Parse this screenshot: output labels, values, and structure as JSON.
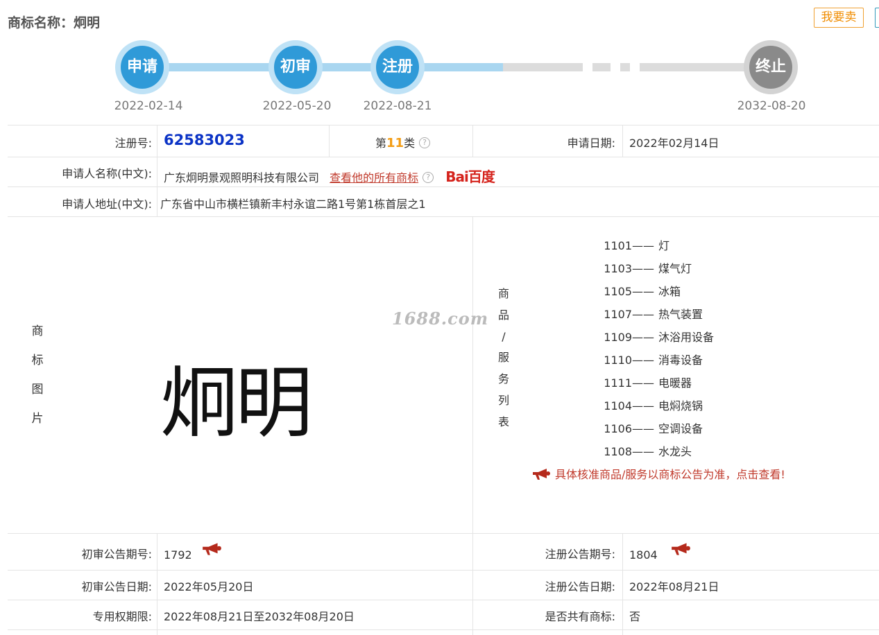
{
  "header": {
    "title": "商标名称：炯明",
    "sell_button": "我要卖"
  },
  "progress": {
    "steps": [
      {
        "label": "申请",
        "date": "2022-02-14"
      },
      {
        "label": "初审",
        "date": "2022-05-20"
      },
      {
        "label": "注册",
        "date": "2022-08-21"
      },
      {
        "label": "终止",
        "date": "2032-08-20"
      }
    ]
  },
  "info": {
    "reg_no_label": "注册号:",
    "reg_no": "62583023",
    "class_prefix": "第",
    "class_num": "11",
    "class_suffix": "类",
    "apply_date_label": "申请日期:",
    "apply_date": "2022年02月14日",
    "applicant_label": "申请人名称(中文):",
    "applicant": "广东炯明景观照明科技有限公司",
    "all_marks_link": "查看他的所有商标",
    "baidu_label": "Bai百度",
    "address_label": "申请人地址(中文):",
    "address": "广东省中山市横栏镇新丰村永谊二路1号第1栋首层之1",
    "image_label_chars": [
      "商",
      "标",
      "图",
      "片"
    ],
    "mark_text": "炯明",
    "watermark": "1688.com",
    "goods_label_chars": [
      "商",
      "品",
      "/",
      "服",
      "务",
      "列",
      "表"
    ],
    "goods": [
      {
        "code": "1101",
        "sep": "——",
        "name": "灯"
      },
      {
        "code": "1103",
        "sep": "——",
        "name": "煤气灯"
      },
      {
        "code": "1105",
        "sep": "——",
        "name": "冰箱"
      },
      {
        "code": "1107",
        "sep": "——",
        "name": "热气装置"
      },
      {
        "code": "1109",
        "sep": "——",
        "name": "沐浴用设备"
      },
      {
        "code": "1110",
        "sep": "——",
        "name": "消毒设备"
      },
      {
        "code": "1111",
        "sep": "——",
        "name": "电暖器"
      },
      {
        "code": "1104",
        "sep": "——",
        "name": "电焖烧锅"
      },
      {
        "code": "1106",
        "sep": "——",
        "name": "空调设备"
      },
      {
        "code": "1108",
        "sep": "——",
        "name": "水龙头"
      }
    ],
    "goods_notice": "具体核准商品/服务以商标公告为准，点击查看!",
    "prelim_no_label": "初审公告期号:",
    "prelim_no": "1792",
    "reg_pub_no_label": "注册公告期号:",
    "reg_pub_no": "1804",
    "prelim_date_label": "初审公告日期:",
    "prelim_date": "2022年05月20日",
    "reg_pub_date_label": "注册公告日期:",
    "reg_pub_date": "2022年08月21日",
    "term_label": "专用权期限:",
    "term": "2022年08月21日至2032年08月20日",
    "shared_label": "是否共有商标:",
    "shared": "否"
  },
  "colors": {
    "accent_blue": "#2f9ad8",
    "reg_no": "#0b33c6",
    "link_red": "#c0392b",
    "class_orange": "#f39c12"
  }
}
